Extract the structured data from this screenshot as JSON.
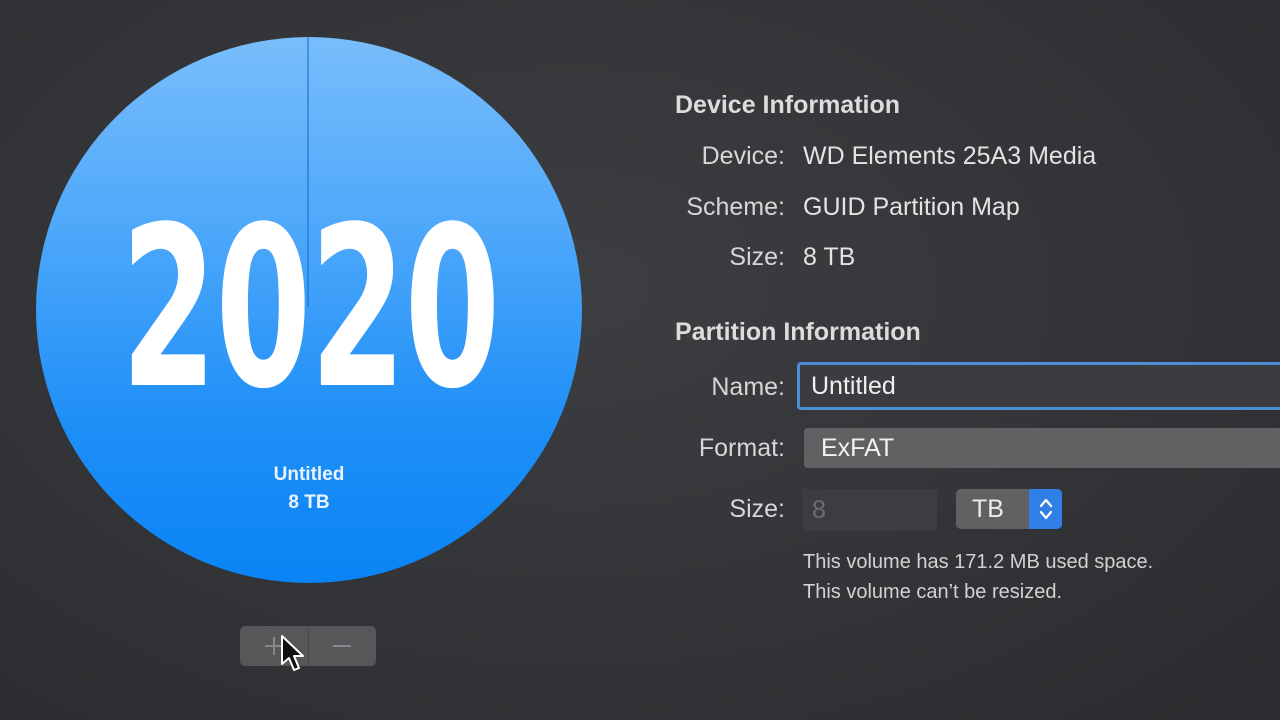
{
  "overlay": {
    "year": "2020"
  },
  "partition_map": {
    "partition_name": "Untitled",
    "partition_size": "8 TB",
    "colors": {
      "partition": "#1f8ff7",
      "partition_light": "#78bdfb"
    }
  },
  "controls": {
    "add_icon": "plus-icon",
    "remove_icon": "minus-icon"
  },
  "device_info": {
    "title": "Device Information",
    "device_label": "Device:",
    "device_value": "WD Elements 25A3 Media",
    "scheme_label": "Scheme:",
    "scheme_value": "GUID Partition Map",
    "size_label": "Size:",
    "size_value": "8 TB"
  },
  "partition_info": {
    "title": "Partition Information",
    "name_label": "Name:",
    "name_value": "Untitled",
    "format_label": "Format:",
    "format_value": "ExFAT",
    "size_label": "Size:",
    "size_value": "8",
    "size_unit": "TB",
    "note_used": "This volume has 171.2 MB used space.",
    "note_resize": "This volume can’t be resized."
  },
  "accent_color": "#2f7fe6"
}
